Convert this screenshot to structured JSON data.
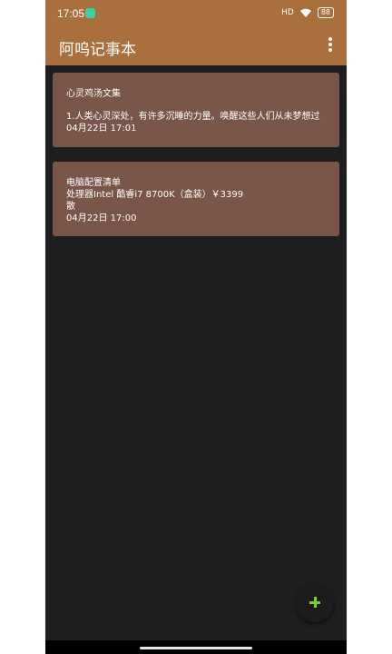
{
  "status": {
    "time": "17:05",
    "signal": "HD",
    "battery": "88"
  },
  "appbar": {
    "title": "阿呜记事本",
    "menu_icon": "more-vert-icon"
  },
  "notes": [
    {
      "title": "心灵鸡汤文集",
      "content": [
        "1.人类心灵深处，有许多沉睡的力量。唤醒这些人们从未梦想过"
      ],
      "date": "04月22日 17:01"
    },
    {
      "title": "电脑配置清单",
      "content": [
        "处理器Intel 酷睿i7 8700K（盒装）￥3399",
        "散"
      ],
      "date": "04月22日 17:00"
    }
  ],
  "fab": {
    "icon": "plus-icon"
  },
  "colors": {
    "appbar": "#a96f3d",
    "card": "#7a5549",
    "background": "#1f1f1f",
    "fab_plus": "#7bd124"
  }
}
